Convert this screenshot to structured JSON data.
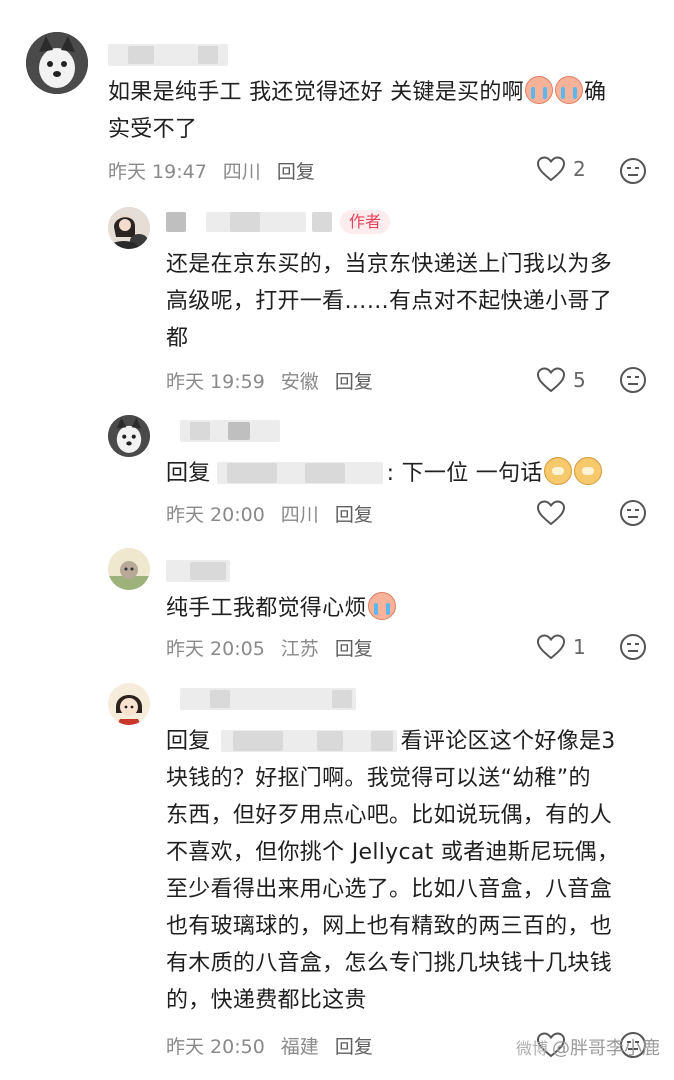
{
  "comments": [
    {
      "text": "如果是纯手工 我还觉得还好 关键是买的啊",
      "text_tail_line1": "确",
      "text_line2": "实受不了",
      "time": "昨天 19:47",
      "location": "四川",
      "reply_label": "回复",
      "likes": "2"
    },
    {
      "badge": "作者",
      "text_lines": [
        "还是在京东买的，当京东快递送上门我以为多",
        "高级呢，打开一看……有点对不起快递小哥了",
        "都"
      ],
      "time": "昨天 19:59",
      "location": "安徽",
      "reply_label": "回复",
      "likes": "5"
    },
    {
      "reply_prefix": "回复",
      "text": ": 下一位 一句话",
      "time": "昨天 20:00",
      "location": "四川",
      "reply_label": "回复",
      "likes": ""
    },
    {
      "text": "纯手工我都觉得心烦",
      "time": "昨天 20:05",
      "location": "江苏",
      "reply_label": "回复",
      "likes": "1"
    },
    {
      "reply_prefix": "回复",
      "text_first": "看评论区这个好像是3",
      "text_lines": [
        "块钱的？好抠门啊。我觉得可以送“幼稚”的",
        "东西，但好歹用点心吧。比如说玩偶，有的人",
        "不喜欢，但你挑个 Jellycat 或者迪斯尼玩偶，",
        "至少看得出来用心选了。比如八音盒，八音盒",
        "也有玻璃球的，网上也有精致的两三百的，也",
        "有木质的八音盒，怎么专门挑几块钱十几块钱",
        "的，快递费都比这贵"
      ],
      "time": "昨天 20:50",
      "location": "福建",
      "reply_label": "回复",
      "likes": ""
    }
  ],
  "watermark": {
    "prefix": "微博",
    "text": "@胖哥李小鹿"
  },
  "icons": {
    "like": "heart-outline-icon",
    "dislike": "meh-face-icon"
  }
}
